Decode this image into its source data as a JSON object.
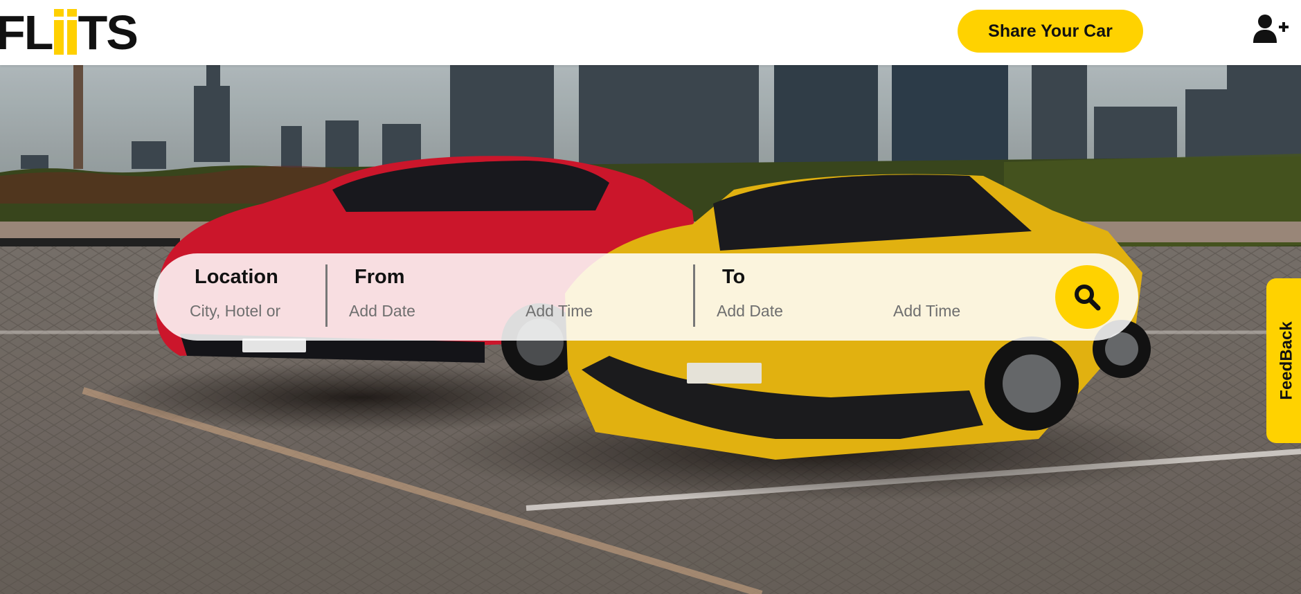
{
  "header": {
    "logo": {
      "left": "FL",
      "right": "TS",
      "accent_color": "#ffd000"
    },
    "share_button": "Share Your Car",
    "account_icon": "user-plus-icon"
  },
  "search": {
    "location": {
      "label": "Location",
      "placeholder": "City, Hotel or"
    },
    "from": {
      "label": "From",
      "date_placeholder": "Add Date",
      "time_placeholder": "Add Time"
    },
    "to": {
      "label": "To",
      "date_placeholder": "Add Date",
      "time_placeholder": "Add Time"
    },
    "search_icon": "search-icon"
  },
  "feedback_tab": "FeedBack",
  "colors": {
    "accent": "#ffd200",
    "text": "#111111"
  }
}
